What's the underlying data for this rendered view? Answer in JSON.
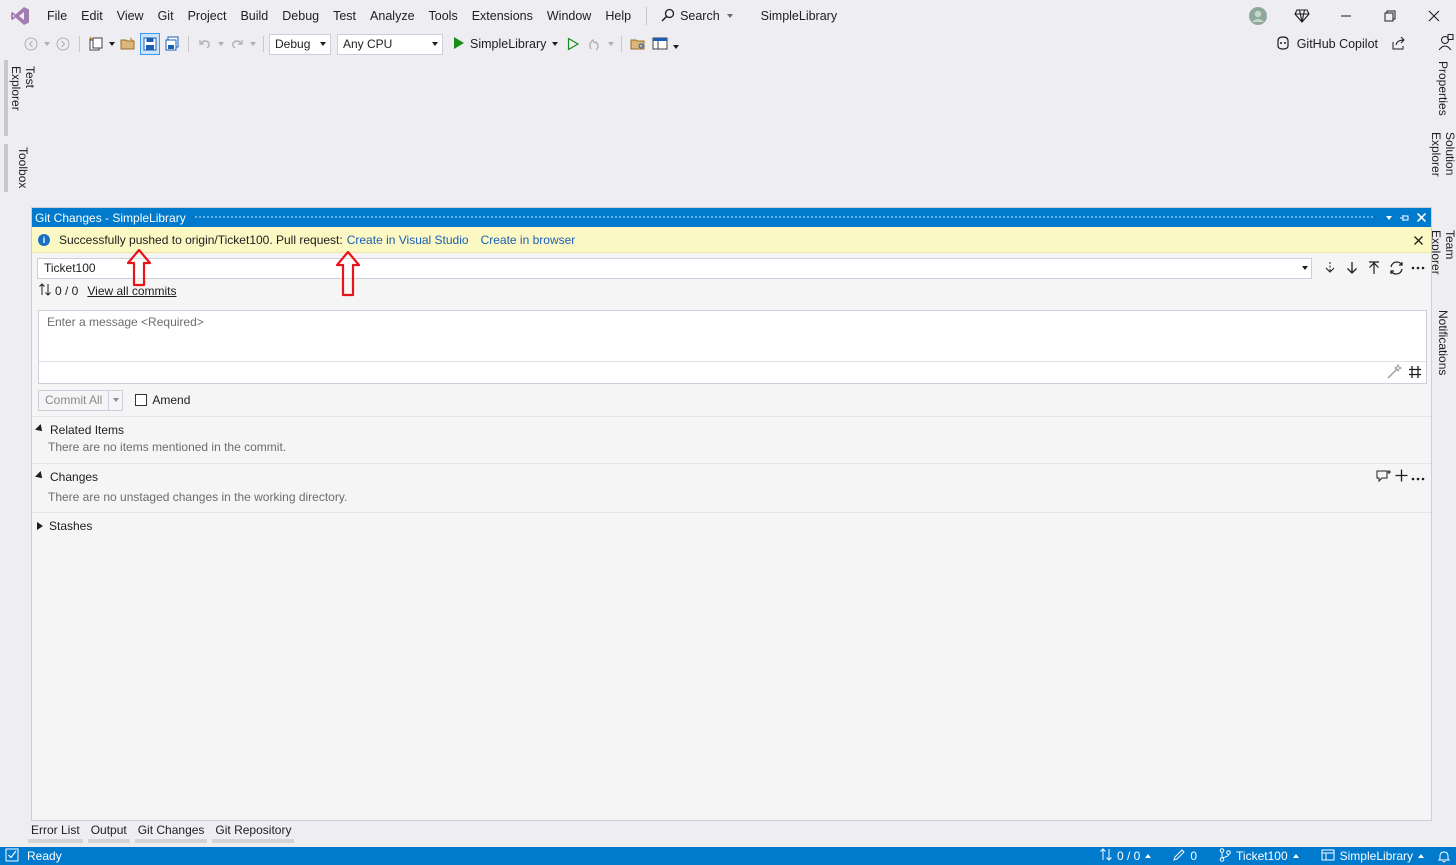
{
  "menu": {
    "items": [
      "File",
      "Edit",
      "View",
      "Git",
      "Project",
      "Build",
      "Debug",
      "Test",
      "Analyze",
      "Tools",
      "Extensions",
      "Window",
      "Help"
    ],
    "search_label": "Search",
    "app_title": "SimpleLibrary"
  },
  "toolbar": {
    "config": "Debug",
    "platform": "Any CPU",
    "run_target": "SimpleLibrary",
    "copilot_label": "GitHub Copilot"
  },
  "side_left": [
    "Test Explorer",
    "Toolbox"
  ],
  "side_right": [
    "Properties",
    "Solution Explorer",
    "Team Explorer",
    "Notifications"
  ],
  "panel": {
    "title": "Git Changes - SimpleLibrary",
    "info": {
      "message": "Successfully pushed to origin/Ticket100. Pull request:",
      "link_vs": "Create in Visual Studio",
      "link_browser": "Create in browser"
    },
    "branch": "Ticket100",
    "commit_counts": "0 / 0",
    "view_all_commits": "View all commits",
    "message_placeholder": "Enter a message <Required>",
    "commit_all": "Commit All",
    "amend": "Amend",
    "sections": {
      "related_title": "Related Items",
      "related_body": "There are no items mentioned in the commit.",
      "changes_title": "Changes",
      "changes_body": "There are no unstaged changes in the working directory.",
      "stashes_title": "Stashes"
    }
  },
  "bottom_tabs": [
    "Error List",
    "Output",
    "Git Changes",
    "Git Repository"
  ],
  "status": {
    "ready": "Ready",
    "sync": "0 / 0",
    "edits": "0",
    "branch": "Ticket100",
    "repo": "SimpleLibrary"
  },
  "colors": {
    "accent": "#007acc",
    "info_bar": "#fcf8c4",
    "link": "#1a5fb4",
    "annotation_arrow": "#e8141c"
  }
}
